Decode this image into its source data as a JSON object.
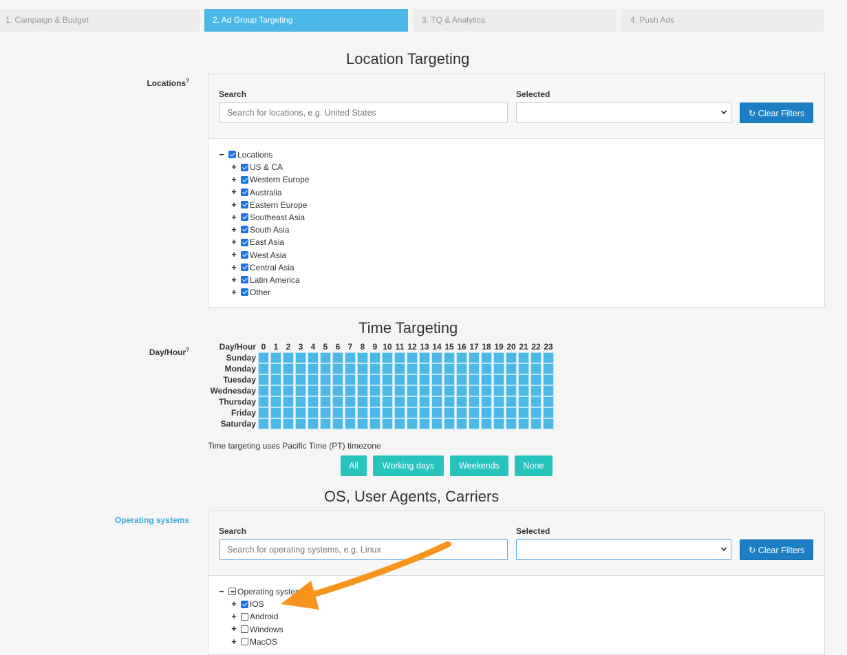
{
  "steps": [
    {
      "label": "1. Campaign & Budget"
    },
    {
      "label": "2. Ad Group Targeting"
    },
    {
      "label": "3. TQ & Analytics"
    },
    {
      "label": "4. Push Ads"
    }
  ],
  "location": {
    "title": "Location Targeting",
    "side_label": "Locations",
    "help_mark": "?",
    "search_label": "Search",
    "search_placeholder": "Search for locations, e.g. United States",
    "selected_label": "Selected",
    "clear_label": "Clear Filters",
    "root": {
      "label": "Locations",
      "checked": true
    },
    "items": [
      {
        "label": "US & CA",
        "checked": true
      },
      {
        "label": "Western Europe",
        "checked": true
      },
      {
        "label": "Australia",
        "checked": true
      },
      {
        "label": "Eastern Europe",
        "checked": true
      },
      {
        "label": "Southeast Asia",
        "checked": true
      },
      {
        "label": "South Asia",
        "checked": true
      },
      {
        "label": "East Asia",
        "checked": true
      },
      {
        "label": "West Asia",
        "checked": true
      },
      {
        "label": "Central Asia",
        "checked": true
      },
      {
        "label": "Latin America",
        "checked": true
      },
      {
        "label": "Other",
        "checked": true
      }
    ]
  },
  "time": {
    "title": "Time Targeting",
    "side_label": "Day/Hour",
    "help_mark": "?",
    "corner_label": "Day/Hour",
    "hours": [
      "0",
      "1",
      "2",
      "3",
      "4",
      "5",
      "6",
      "7",
      "8",
      "9",
      "10",
      "11",
      "12",
      "13",
      "14",
      "15",
      "16",
      "17",
      "18",
      "19",
      "20",
      "21",
      "22",
      "23"
    ],
    "days": [
      "Sunday",
      "Monday",
      "Tuesday",
      "Wednesday",
      "Thursday",
      "Friday",
      "Saturday"
    ],
    "all_selected": true,
    "timezone_note": "Time targeting uses Pacific Time (PT) timezone",
    "buttons": {
      "all": "All",
      "working": "Working days",
      "weekends": "Weekends",
      "none": "None"
    }
  },
  "os": {
    "title": "OS, User Agents, Carriers",
    "side_label": "Operating systems",
    "search_label": "Search",
    "search_placeholder": "Search for operating systems, e.g. Linux",
    "selected_label": "Selected",
    "clear_label": "Clear Filters",
    "root": {
      "label": "Operating systems",
      "state": "partial"
    },
    "items": [
      {
        "label": "IOS",
        "checked": true
      },
      {
        "label": "Android",
        "checked": false
      },
      {
        "label": "Windows",
        "checked": false
      },
      {
        "label": "MacOS",
        "checked": false
      }
    ]
  },
  "colors": {
    "accent": "#4cb8e8",
    "button_blue": "#1d7ec4",
    "button_teal": "#26c4bd",
    "annotation_arrow": "#f7941d"
  }
}
